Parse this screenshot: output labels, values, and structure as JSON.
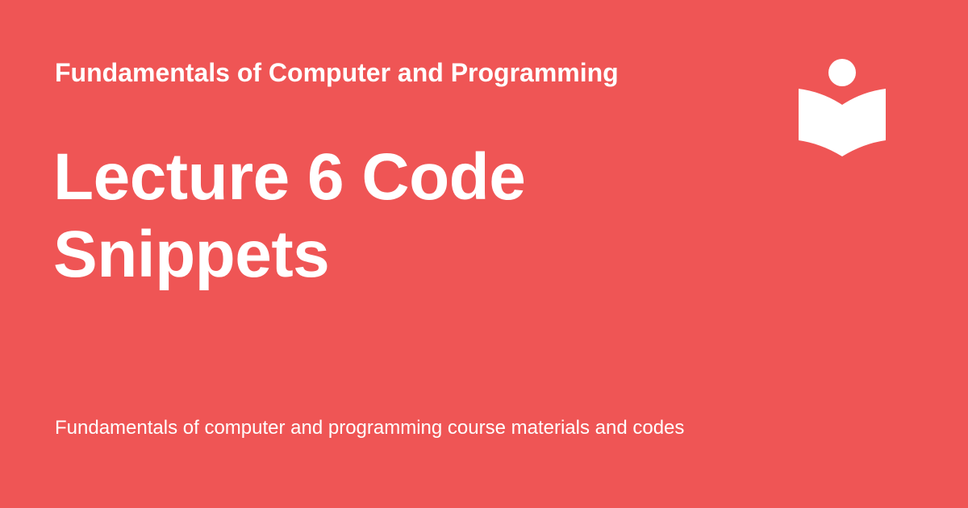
{
  "card": {
    "site_name": "Fundamentals of Computer and Programming",
    "title": "Lecture 6 Code Snippets",
    "description": "Fundamentals of computer and programming course materials and codes",
    "logo_icon": "reader-book-icon",
    "colors": {
      "background": "#EF5555",
      "text": "#FFFFFF"
    }
  }
}
